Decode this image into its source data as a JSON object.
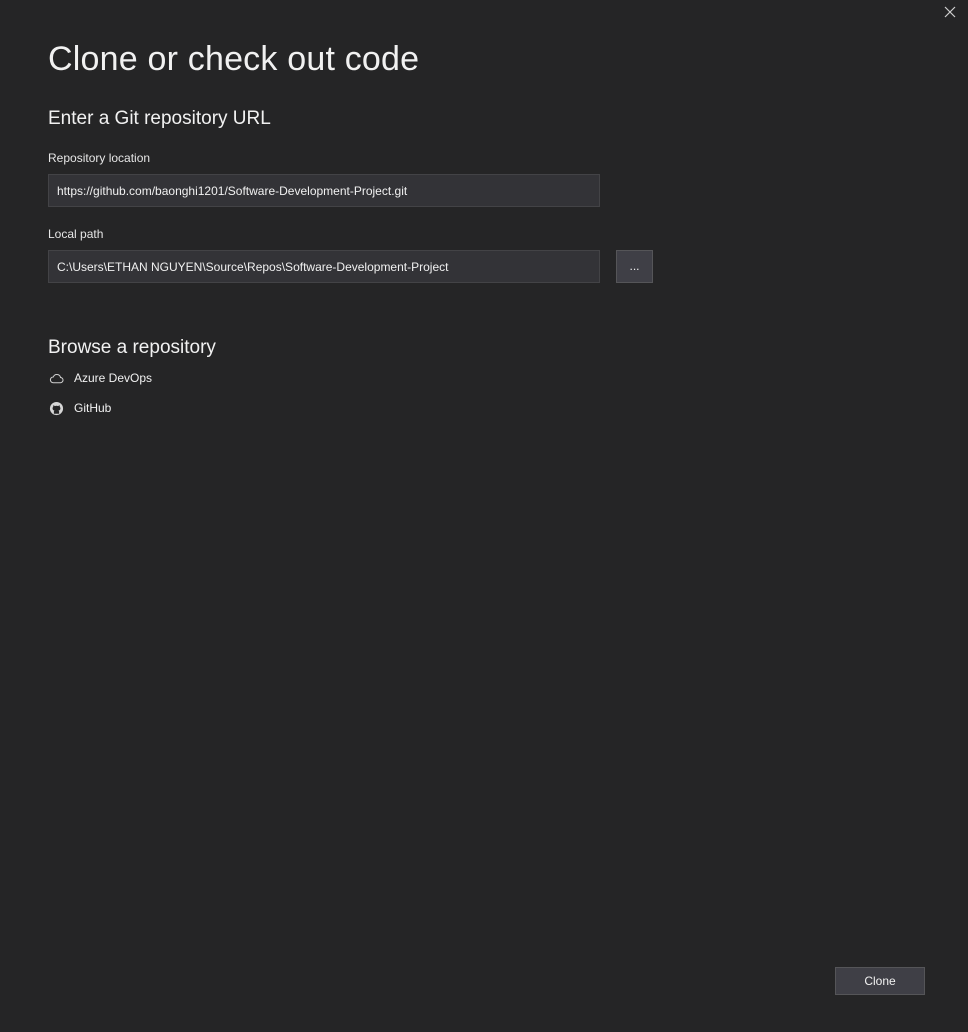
{
  "dialog": {
    "title": "Clone or check out code",
    "close_icon": "close-icon"
  },
  "git_section": {
    "heading": "Enter a Git repository URL",
    "repository_location": {
      "label": "Repository location",
      "value": "https://github.com/baonghi1201/Software-Development-Project.git"
    },
    "local_path": {
      "label": "Local path",
      "value": "C:\\Users\\ETHAN NGUYEN\\Source\\Repos\\Software-Development-Project",
      "browse_label": "..."
    }
  },
  "browse_section": {
    "heading": "Browse a repository",
    "items": [
      {
        "label": "Azure DevOps",
        "icon": "cloud-icon"
      },
      {
        "label": "GitHub",
        "icon": "github-icon"
      }
    ]
  },
  "footer": {
    "clone_label": "Clone"
  }
}
